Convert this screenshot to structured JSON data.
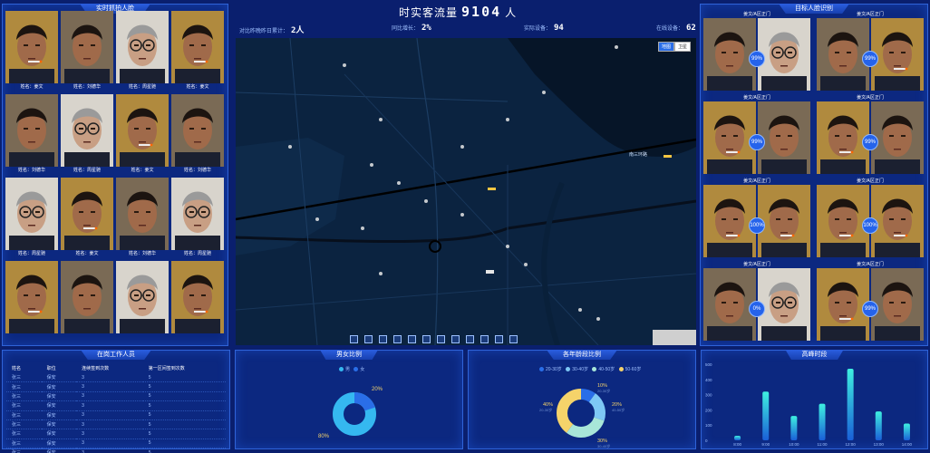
{
  "left_panel": {
    "title": "实时抓拍人脸",
    "faces": [
      {
        "label": "姓名：姜文",
        "type": "a"
      },
      {
        "label": "姓名：刘德华",
        "type": "b"
      },
      {
        "label": "姓名：周星驰",
        "type": "c"
      },
      {
        "label": "姓名：姜文",
        "type": "a"
      },
      {
        "label": "姓名：刘德华",
        "type": "b"
      },
      {
        "label": "姓名：周星驰",
        "type": "c"
      },
      {
        "label": "姓名：姜文",
        "type": "a"
      },
      {
        "label": "姓名：刘德华",
        "type": "b"
      },
      {
        "label": "姓名：周星驰",
        "type": "c"
      },
      {
        "label": "姓名：姜文",
        "type": "a"
      },
      {
        "label": "姓名：刘德华",
        "type": "b"
      },
      {
        "label": "姓名：周星驰",
        "type": "c"
      },
      {
        "label": "",
        "type": "a"
      },
      {
        "label": "",
        "type": "b"
      },
      {
        "label": "",
        "type": "c"
      },
      {
        "label": "",
        "type": "a"
      }
    ]
  },
  "header": {
    "title_prefix": "时实客流量",
    "count": "9104",
    "title_suffix": "人",
    "stats": [
      {
        "label": "对比昨晚昨日累计：",
        "value": "2人"
      },
      {
        "label": "同比增长：",
        "value": "2%"
      },
      {
        "label": "实际设备：",
        "value": "94"
      },
      {
        "label": "在线设备：",
        "value": "62"
      }
    ]
  },
  "map": {
    "btn_map": "地图",
    "btn_satellite": "卫星",
    "road_label": "南三环路"
  },
  "right_panel": {
    "title": "目标人脸识别",
    "items": [
      {
        "label": "姜文/A区正门",
        "score": "99%",
        "left": "b",
        "right": "c"
      },
      {
        "label": "姜文/A区正门",
        "score": "99%",
        "left": "b",
        "right": "a"
      },
      {
        "label": "姜文/A区正门",
        "score": "99%",
        "left": "a",
        "right": "b"
      },
      {
        "label": "姜文/A区正门",
        "score": "99%",
        "left": "a",
        "right": "b"
      },
      {
        "label": "姜文/A区正门",
        "score": "100%",
        "left": "a",
        "right": "a"
      },
      {
        "label": "姜文/A区正门",
        "score": "100%",
        "left": "a",
        "right": "a"
      },
      {
        "label": "姜文/A区正门",
        "score": "0%",
        "left": "b",
        "right": "c"
      },
      {
        "label": "姜文/A区正门",
        "score": "99%",
        "left": "a",
        "right": "b"
      }
    ]
  },
  "staff_panel": {
    "title": "在岗工作人员",
    "headers": [
      "姓名",
      "职位",
      "连续签到次数",
      "第一区间签到次数"
    ],
    "rows": [
      [
        "张三",
        "保安",
        "3",
        "5"
      ],
      [
        "张三",
        "保安",
        "3",
        "5"
      ],
      [
        "张三",
        "保安",
        "3",
        "5"
      ],
      [
        "张三",
        "保安",
        "3",
        "5"
      ],
      [
        "张三",
        "保安",
        "3",
        "5"
      ],
      [
        "张三",
        "保安",
        "3",
        "5"
      ],
      [
        "张三",
        "保安",
        "3",
        "5"
      ],
      [
        "张三",
        "保安",
        "3",
        "5"
      ],
      [
        "张三",
        "保安",
        "3",
        "5"
      ]
    ]
  },
  "gender_panel": {
    "title": "男女比例",
    "legend": [
      "男",
      "女"
    ],
    "label_female": "20%",
    "label_male": "80%",
    "colors": [
      "#35b8f0",
      "#2a6ee8"
    ]
  },
  "age_panel": {
    "title": "各年龄段比例",
    "legend": [
      "20-30岁",
      "30-40岁",
      "40-50岁",
      "50-60岁"
    ],
    "labels": [
      {
        "pct": "10%",
        "range": "20-30岁"
      },
      {
        "pct": "20%",
        "range": "40-50岁"
      },
      {
        "pct": "30%",
        "range": "30-40岁"
      },
      {
        "pct": "40%",
        "range": "20-30岁"
      }
    ],
    "colors": [
      "#2a6ee8",
      "#7ec8f5",
      "#a8e6d8",
      "#f5d36a"
    ]
  },
  "chart_data": {
    "type": "bar",
    "title": "高峰时段",
    "categories": [
      "8:00",
      "9:00",
      "10:00",
      "11:00",
      "12:00",
      "13:00",
      "14:00"
    ],
    "values": [
      30,
      320,
      160,
      240,
      470,
      190,
      110
    ],
    "ylim": [
      0,
      500
    ],
    "yticks": [
      "0",
      "100",
      "200",
      "300",
      "400",
      "500"
    ]
  }
}
